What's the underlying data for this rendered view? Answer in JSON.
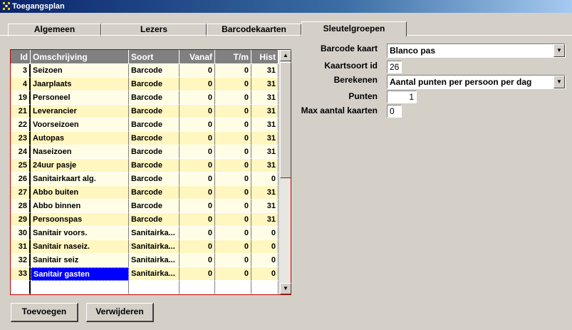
{
  "window": {
    "title": "Toegangsplan"
  },
  "tabs": [
    {
      "label": "Algemeen",
      "active": false
    },
    {
      "label": "Lezers",
      "active": false
    },
    {
      "label": "Barcodekaarten",
      "active": false
    },
    {
      "label": "Sleutelgroepen",
      "active": true
    }
  ],
  "table": {
    "columns": [
      "Id",
      "Omschrijving",
      "Soort",
      "Vanaf",
      "T/m",
      "Hist"
    ],
    "rows": [
      [
        "3",
        "Seizoen",
        "Barcode",
        "0",
        "0",
        "31"
      ],
      [
        "4",
        "Jaarplaats",
        "Barcode",
        "0",
        "0",
        "31"
      ],
      [
        "19",
        "Personeel",
        "Barcode",
        "0",
        "0",
        "31"
      ],
      [
        "21",
        "Leverancier",
        "Barcode",
        "0",
        "0",
        "31"
      ],
      [
        "22",
        "Voorseizoen",
        "Barcode",
        "0",
        "0",
        "31"
      ],
      [
        "23",
        "Autopas",
        "Barcode",
        "0",
        "0",
        "31"
      ],
      [
        "24",
        "Naseizoen",
        "Barcode",
        "0",
        "0",
        "31"
      ],
      [
        "25",
        "24uur pasje",
        "Barcode",
        "0",
        "0",
        "31"
      ],
      [
        "26",
        "Sanitairkaart alg.",
        "Barcode",
        "0",
        "0",
        "0"
      ],
      [
        "27",
        "Abbo buiten",
        "Barcode",
        "0",
        "0",
        "31"
      ],
      [
        "28",
        "Abbo binnen",
        "Barcode",
        "0",
        "0",
        "31"
      ],
      [
        "29",
        "Persoonspas",
        "Barcode",
        "0",
        "0",
        "31"
      ],
      [
        "30",
        "Sanitair voors.",
        "Sanitairka...",
        "0",
        "0",
        "0"
      ],
      [
        "31",
        "Sanitair naseiz.",
        "Sanitairka...",
        "0",
        "0",
        "0"
      ],
      [
        "32",
        "Sanitair seiz",
        "Sanitairka...",
        "0",
        "0",
        "0"
      ],
      [
        "33",
        "Sanitair gasten",
        "Sanitairka...",
        "0",
        "0",
        "0"
      ]
    ],
    "selected_row_id": "33"
  },
  "form": {
    "barcode_kaart_label": "Barcode kaart",
    "barcode_kaart_value": "Blanco pas",
    "kaartsoort_id_label": "Kaartsoort id",
    "kaartsoort_id_value": "26",
    "berekenen_label": "Berekenen",
    "berekenen_value": "Aantal punten per persoon per dag",
    "punten_label": "Punten",
    "punten_value": "1",
    "max_aantal_label": "Max aantal kaarten",
    "max_aantal_value": "0"
  },
  "buttons": {
    "add": "Toevoegen",
    "delete": "Verwijderen"
  },
  "icons": {
    "app": "app-icon",
    "scroll_up": "scroll-up-icon",
    "scroll_down": "scroll-down-icon",
    "dropdown": "chevron-down-icon"
  },
  "colors": {
    "selection": "#0000ff",
    "grid_border": "#c00000",
    "row_a": "#fffde6",
    "row_b": "#fff6c0",
    "header": "#808080"
  }
}
